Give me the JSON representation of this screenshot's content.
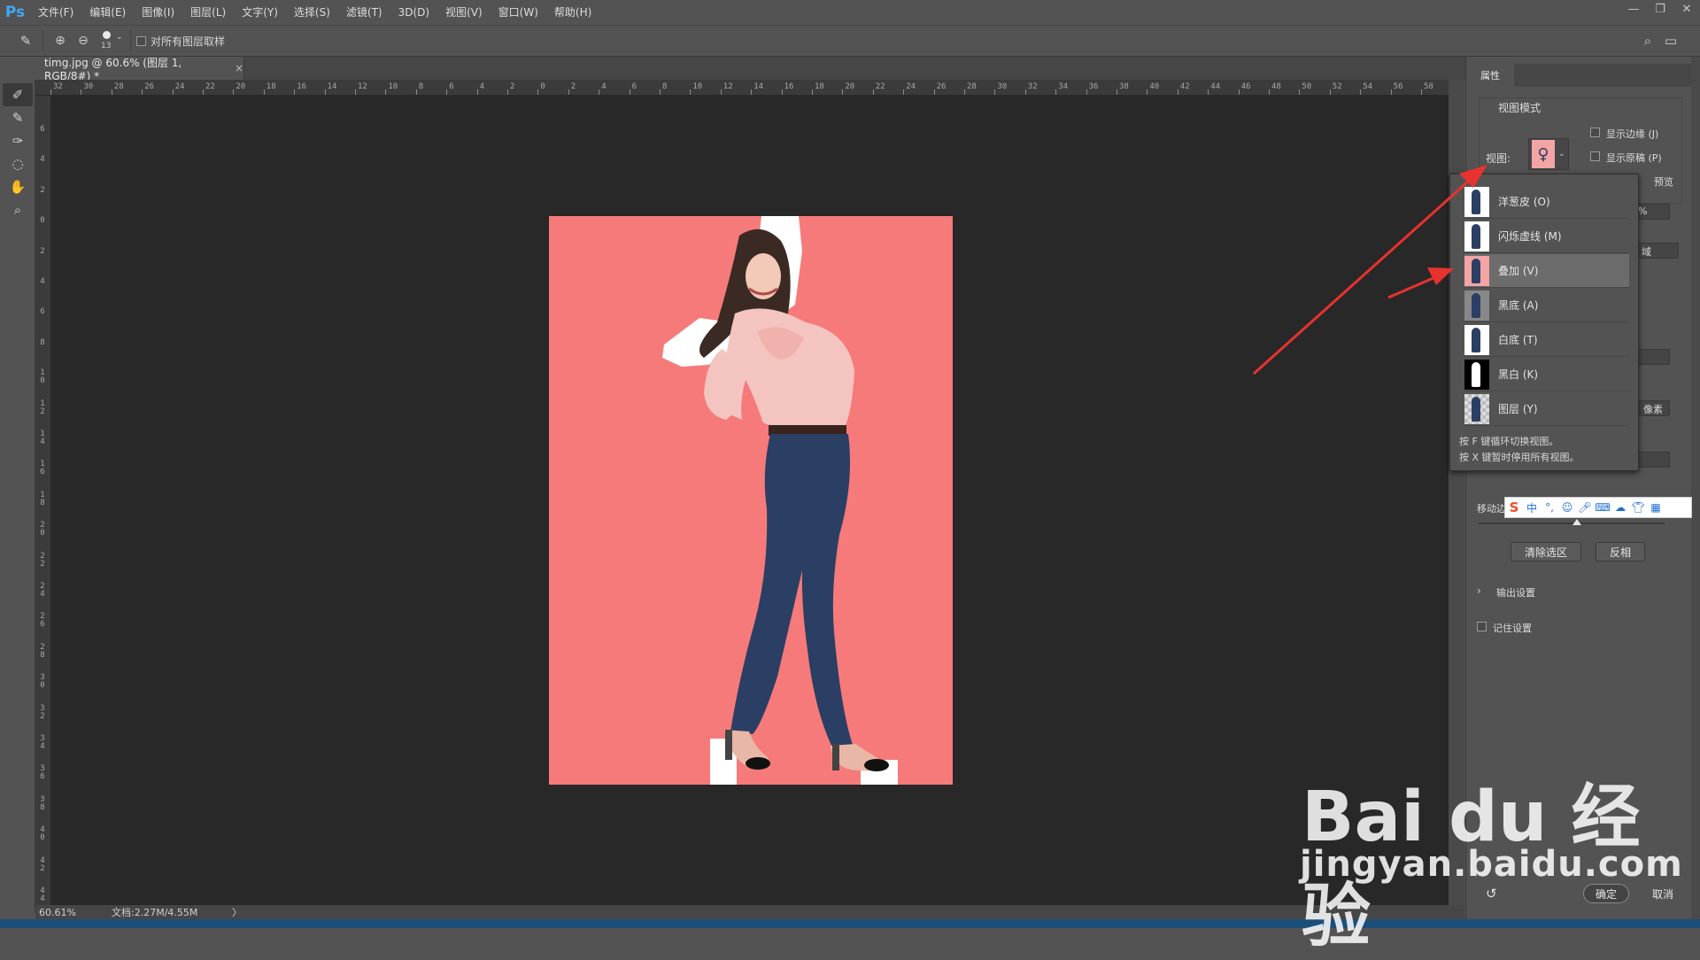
{
  "app": {
    "logo": "Ps"
  },
  "menubar": {
    "items": [
      "文件(F)",
      "编辑(E)",
      "图像(I)",
      "图层(L)",
      "文字(Y)",
      "选择(S)",
      "滤镜(T)",
      "3D(D)",
      "视图(V)",
      "窗口(W)",
      "帮助(H)"
    ]
  },
  "window_controls": {
    "minimize": "—",
    "restore": "❐",
    "close": "✕"
  },
  "options_bar": {
    "brush_size": "13",
    "sample_all_layers": "对所有图层取样"
  },
  "document_tab": {
    "title": "timg.jpg @ 60.6% (图层 1, RGB/8#) *",
    "close": "×"
  },
  "ruler_h": [
    "32",
    "30",
    "28",
    "26",
    "24",
    "22",
    "20",
    "18",
    "16",
    "14",
    "12",
    "10",
    "8",
    "6",
    "4",
    "2",
    "0",
    "2",
    "4",
    "6",
    "8",
    "10",
    "12",
    "14",
    "16",
    "18",
    "20",
    "22",
    "24",
    "26",
    "28",
    "30",
    "32",
    "34",
    "36",
    "38",
    "40",
    "42",
    "44",
    "46",
    "48",
    "50",
    "52",
    "54",
    "56",
    "58"
  ],
  "ruler_v": [
    "6",
    "4",
    "2",
    "0",
    "2",
    "4",
    "6",
    "8",
    "10",
    "12",
    "14",
    "16",
    "18",
    "20",
    "22",
    "24",
    "26",
    "28",
    "30",
    "32",
    "34",
    "36",
    "38",
    "40",
    "42",
    "44"
  ],
  "status": {
    "zoom": "60.61%",
    "doc": "文档:2.27M/4.55M",
    "arrow": "〉"
  },
  "properties": {
    "tab": "属性",
    "view_mode_title": "视图模式",
    "view_label": "视图:",
    "show_edge": "显示边缘 (J)",
    "show_original": "显示原稿 (P)",
    "partial_preview": "预览",
    "percent": "%",
    "region": "域",
    "pixels": "像素",
    "move_edge": "移动边",
    "clear_selection": "清除选区",
    "invert": "反相",
    "output_settings": "输出设置",
    "remember_settings": "记住设置",
    "ok": "确定",
    "cancel": "取消"
  },
  "view_dropdown": {
    "items": [
      {
        "label": "洋葱皮 (O)",
        "thumb": "onion"
      },
      {
        "label": "闪烁虚线 (M)",
        "thumb": "marching"
      },
      {
        "label": "叠加 (V)",
        "thumb": "overlay"
      },
      {
        "label": "黑底 (A)",
        "thumb": "black"
      },
      {
        "label": "白底 (T)",
        "thumb": "white"
      },
      {
        "label": "黑白 (K)",
        "thumb": "bw"
      },
      {
        "label": "图层 (Y)",
        "thumb": "layer"
      }
    ],
    "hint1": "按 F 键循环切换视图。",
    "hint2": "按 X 键暂时停用所有视图。"
  },
  "ime": {
    "logo": "S",
    "lang": "中",
    "punct": "°,"
  },
  "watermark": {
    "logo": "Bai du 经验",
    "url": "jingyan.baidu.com"
  },
  "colors": {
    "overlay": "#f67a7a",
    "arrow": "#e8322e",
    "accent": "#3da8f5"
  }
}
